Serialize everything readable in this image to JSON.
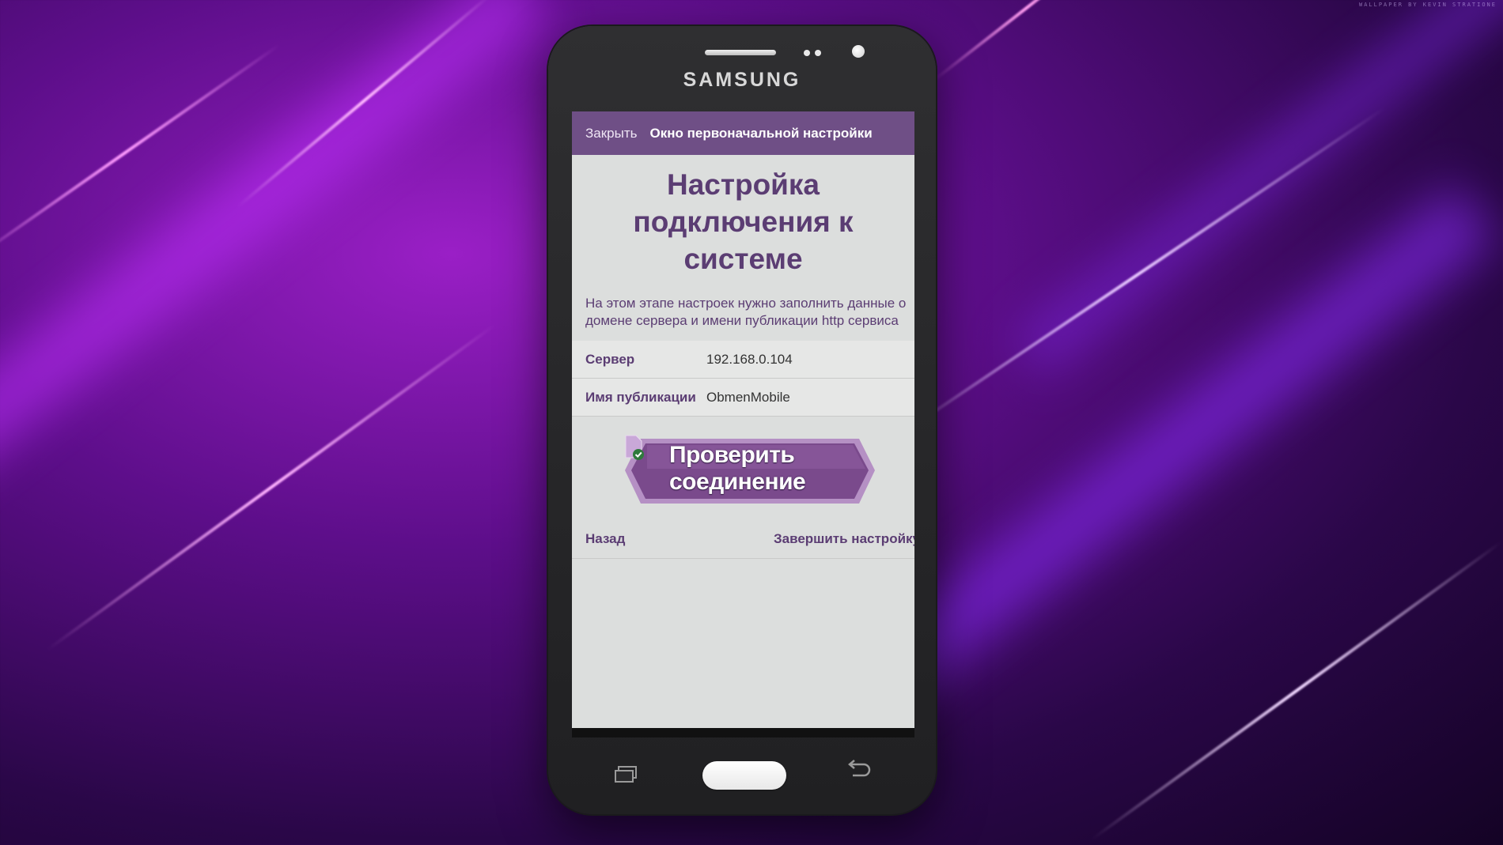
{
  "wallpaper": {
    "watermark": "WALLPAPER BY KEVIN STRATIONE"
  },
  "phone": {
    "brand": "SAMSUNG"
  },
  "app": {
    "header": {
      "close_label": "Закрыть",
      "title": "Окно первоначальной настройки"
    },
    "heading": "Настройка подключения к системе",
    "description": "На этом этапе настроек нужно заполнить данные о домене сервера и имени публикации http сервиса",
    "fields": [
      {
        "label": "Сервер",
        "value": "192.168.0.104"
      },
      {
        "label": "Имя публикации",
        "value": "ObmenMobile"
      }
    ],
    "check_button_label": "Проверить соединение",
    "footer": {
      "back_label": "Назад",
      "finish_label": "Завершить настройку"
    }
  },
  "colors": {
    "accent": "#6f4f86",
    "heading": "#5b3d73",
    "button": "#7a4a8c"
  }
}
